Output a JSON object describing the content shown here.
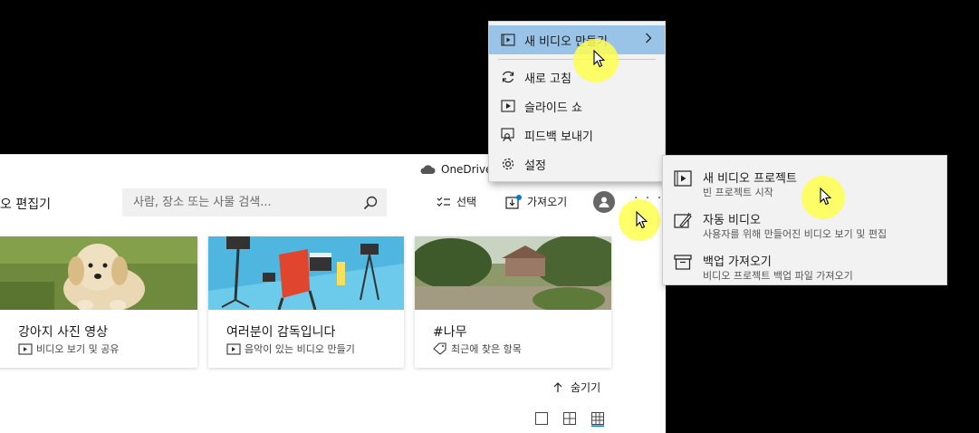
{
  "app": {
    "onedrive_label": "OneDrive",
    "title": "오 편집기",
    "search_placeholder": "사람, 장소 또는 사물 검색...",
    "select_label": "선택",
    "import_label": "가져오기",
    "more_label": "· · ·",
    "hide_label": "숨기기"
  },
  "cards": [
    {
      "title": "강아지 사진 영상",
      "subtitle": "비디오 보기 및 공유",
      "icon": "video-icon"
    },
    {
      "title": "여러분이 감독입니다",
      "subtitle": "음악이 있는 비디오 만들기",
      "icon": "video-icon"
    },
    {
      "title": "#나무",
      "subtitle": "최근에 찾은 항목",
      "icon": "tag-icon"
    }
  ],
  "menu": {
    "items": [
      {
        "label": "새 비디오 만들기",
        "icon": "new-video-icon"
      },
      {
        "label": "새로 고침",
        "icon": "refresh-icon"
      },
      {
        "label": "슬라이드 쇼",
        "icon": "slideshow-icon"
      },
      {
        "label": "피드백 보내기",
        "icon": "feedback-icon"
      },
      {
        "label": "설정",
        "icon": "gear-icon"
      }
    ]
  },
  "submenu": {
    "items": [
      {
        "title": "새 비디오 프로젝트",
        "desc": "빈 프로젝트 시작",
        "icon": "video-project-icon"
      },
      {
        "title": "자동 비디오",
        "desc": "사용자를 위해 만들어진 비디오 보기 및 편집",
        "icon": "auto-video-icon"
      },
      {
        "title": "백업 가져오기",
        "desc": "비디오 프로젝트 백업 파일 가져오기",
        "icon": "archive-icon"
      }
    ]
  },
  "colors": {
    "menu_highlight": "#99c4e8",
    "cursor_highlight": "#ffff50",
    "notification_dot": "#0078d4"
  }
}
